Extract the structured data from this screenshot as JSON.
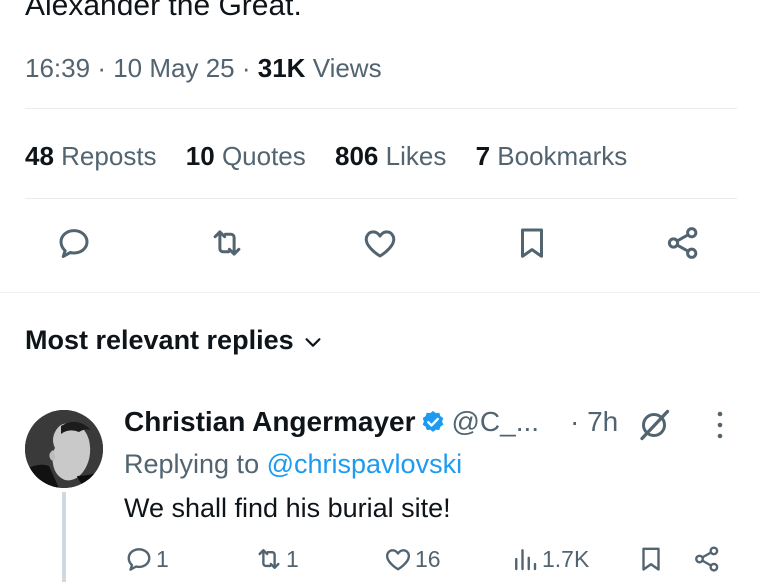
{
  "tweet": {
    "text_tail": "Alexander the Great.",
    "time": "16:39",
    "sep1": "·",
    "date": "10 May 25",
    "sep2": "·",
    "views_count": "31K",
    "views_label": "Views"
  },
  "stats": [
    {
      "count": "48",
      "label": "Reposts"
    },
    {
      "count": "10",
      "label": "Quotes"
    },
    {
      "count": "806",
      "label": "Likes"
    },
    {
      "count": "7",
      "label": "Bookmarks"
    }
  ],
  "actions": [
    "reply-icon",
    "repost-icon",
    "like-icon",
    "bookmark-icon",
    "share-icon"
  ],
  "replies_sort": {
    "label": "Most relevant replies"
  },
  "reply": {
    "name": "Christian Angermayer",
    "handle": "@C_...",
    "time": "· 7h",
    "replying_prefix": "Replying to",
    "replying_to": "@chrispavlovski",
    "text": "We shall find his burial site!",
    "counts": {
      "replies": "1",
      "reposts": "1",
      "likes": "16",
      "views": "1.7K"
    }
  },
  "colors": {
    "text_primary": "#0f1419",
    "text_secondary": "#536471",
    "accent": "#1d9bf0",
    "divider": "#eff3f4"
  }
}
